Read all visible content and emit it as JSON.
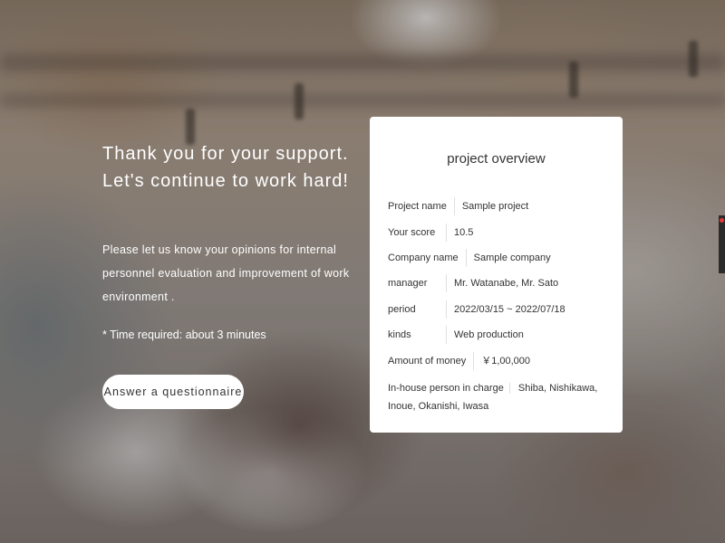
{
  "hero": {
    "headline_line1": "Thank you for your support.",
    "headline_line2": "Let's continue to work hard!",
    "description": "Please let us know your opinions for internal personnel evaluation and improvement of work environment .",
    "time_note": "* Time required: about 3 minutes",
    "cta_label": "Answer a questionnaire"
  },
  "card": {
    "title": "project overview",
    "rows": [
      {
        "label": "Project name",
        "value": "Sample project"
      },
      {
        "label": "Your score",
        "value": "10.5"
      },
      {
        "label": "Company name",
        "value": "Sample company"
      },
      {
        "label": "manager",
        "value": "Mr. Watanabe, Mr. Sato"
      },
      {
        "label": "period",
        "value": "2022/03/15 ~ 2022/07/18"
      },
      {
        "label": "kinds",
        "value": "Web production"
      },
      {
        "label": "Amount of money",
        "value": "￥1,00,000"
      },
      {
        "label": "In-house person in charge",
        "value": "Shiba, Nishikawa, Inoue, Okanishi, Iwasa"
      }
    ]
  },
  "colors": {
    "card_bg": "#ffffff",
    "text_dark": "#333333",
    "hero_text": "#ffffff",
    "rec_dot": "#e53935"
  }
}
